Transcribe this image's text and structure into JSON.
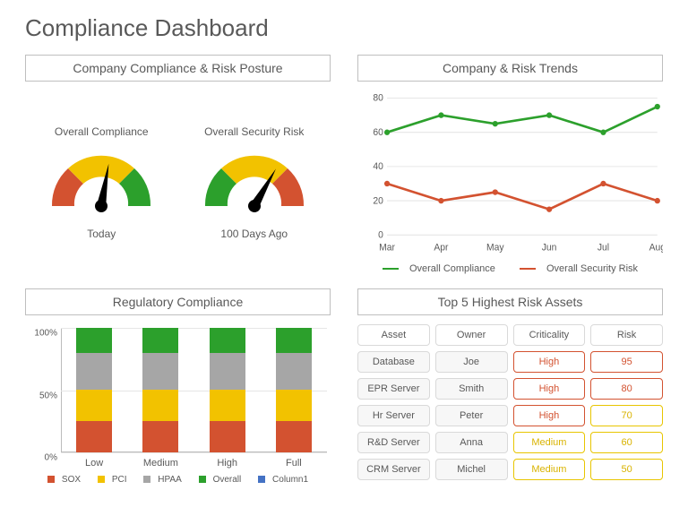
{
  "title": "Compliance Dashboard",
  "colors": {
    "green": "#2ca02c",
    "yellow": "#f2c200",
    "orange": "#d35230",
    "red": "#d35230",
    "grey": "#a6a6a6",
    "blue": "#4472c4"
  },
  "posture": {
    "header": "Company Compliance & Risk Posture",
    "gauges": [
      {
        "top": "Overall Compliance",
        "bottom": "Today",
        "needle_deg": 100
      },
      {
        "top": "Overall Security Risk",
        "bottom": "100 Days Ago",
        "needle_deg": 120
      }
    ]
  },
  "trends": {
    "header": "Company & Risk Trends",
    "legend": {
      "a": "Overall Compliance",
      "b": "Overall Security Risk"
    }
  },
  "regulatory": {
    "header": "Regulatory Compliance",
    "legend": {
      "sox": "SOX",
      "pci": "PCI",
      "hpaa": "HPAA",
      "overall": "Overall",
      "col1": "Column1"
    }
  },
  "risk_assets": {
    "header": "Top 5 Highest Risk Assets",
    "cols": {
      "asset": "Asset",
      "owner": "Owner",
      "crit": "Criticality",
      "risk": "Risk"
    },
    "rows": [
      {
        "asset": "Database",
        "owner": "Joe",
        "crit": "High",
        "crit_level": "high",
        "risk": "95",
        "risk_level": "high"
      },
      {
        "asset": "EPR Server",
        "owner": "Smith",
        "crit": "High",
        "crit_level": "high",
        "risk": "80",
        "risk_level": "high"
      },
      {
        "asset": "Hr Server",
        "owner": "Peter",
        "crit": "High",
        "crit_level": "high",
        "risk": "70",
        "risk_level": "med"
      },
      {
        "asset": "R&D  Server",
        "owner": "Anna",
        "crit": "Medium",
        "crit_level": "medium",
        "risk": "60",
        "risk_level": "med"
      },
      {
        "asset": "CRM Server",
        "owner": "Michel",
        "crit": "Medium",
        "crit_level": "medium",
        "risk": "50",
        "risk_level": "med"
      }
    ]
  },
  "chart_data": [
    {
      "type": "gauge",
      "title": "Company Compliance & Risk Posture",
      "gauges": [
        {
          "label": "Overall Compliance",
          "caption": "Today",
          "angle_deg": 100,
          "zones": [
            "red",
            "yellow",
            "green"
          ]
        },
        {
          "label": "Overall Security Risk",
          "caption": "100 Days Ago",
          "angle_deg": 120,
          "zones": [
            "green",
            "yellow",
            "red"
          ]
        }
      ]
    },
    {
      "type": "line",
      "title": "Company & Risk Trends",
      "categories": [
        "Mar",
        "Apr",
        "May",
        "Jun",
        "Jul",
        "Aug"
      ],
      "ylim": [
        0,
        80
      ],
      "yticks": [
        0,
        20,
        40,
        60,
        80
      ],
      "series": [
        {
          "name": "Overall Compliance",
          "color": "#2ca02c",
          "values": [
            60,
            70,
            65,
            70,
            60,
            75
          ]
        },
        {
          "name": "Overall Security Risk",
          "color": "#d35230",
          "values": [
            30,
            20,
            25,
            15,
            30,
            20
          ]
        }
      ],
      "legend_position": "bottom"
    },
    {
      "type": "bar",
      "stacked": true,
      "percent": true,
      "title": "Regulatory Compliance",
      "categories": [
        "Low",
        "Medium",
        "High",
        "Full"
      ],
      "ylim": [
        0,
        100
      ],
      "yticks": [
        0,
        50,
        100
      ],
      "ytick_labels": [
        "0%",
        "50%",
        "100%"
      ],
      "series": [
        {
          "name": "SOX",
          "color": "#d35230",
          "values": [
            25,
            25,
            25,
            25
          ]
        },
        {
          "name": "PCI",
          "color": "#f2c200",
          "values": [
            25,
            25,
            25,
            25
          ]
        },
        {
          "name": "HPAA",
          "color": "#a6a6a6",
          "values": [
            30,
            30,
            30,
            30
          ]
        },
        {
          "name": "Overall",
          "color": "#2ca02c",
          "values": [
            20,
            20,
            20,
            20
          ]
        },
        {
          "name": "Column1",
          "color": "#4472c4",
          "values": [
            0,
            0,
            0,
            0
          ]
        }
      ],
      "legend_position": "bottom"
    },
    {
      "type": "table",
      "title": "Top 5 Highest Risk Assets",
      "columns": [
        "Asset",
        "Owner",
        "Criticality",
        "Risk"
      ],
      "rows": [
        [
          "Database",
          "Joe",
          "High",
          95
        ],
        [
          "EPR Server",
          "Smith",
          "High",
          80
        ],
        [
          "Hr Server",
          "Peter",
          "High",
          70
        ],
        [
          "R&D  Server",
          "Anna",
          "Medium",
          60
        ],
        [
          "CRM Server",
          "Michel",
          "Medium",
          50
        ]
      ]
    }
  ]
}
